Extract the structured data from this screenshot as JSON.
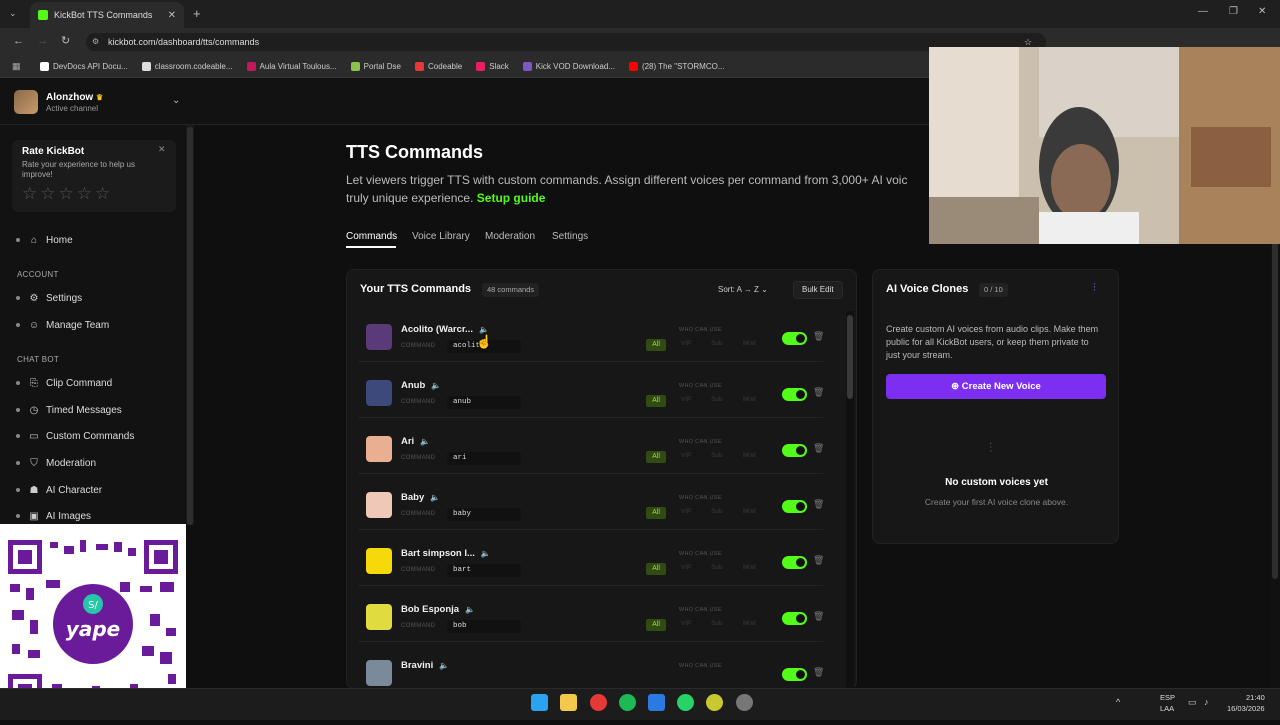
{
  "browser": {
    "tab_title": "KickBot TTS Commands",
    "url": "kickbot.com/dashboard/tts/commands",
    "bookmarks": [
      {
        "label": "DevDocs API Docu...",
        "color": "#ffffff"
      },
      {
        "label": "classroom.codeable...",
        "color": "#dddddd"
      },
      {
        "label": "Aula Virtual Toulous...",
        "color": "#c2185b"
      },
      {
        "label": "Portal Dse",
        "color": "#8bc34a"
      },
      {
        "label": "Codeable",
        "color": "#e53935"
      },
      {
        "label": "Slack",
        "color": "#e91e63"
      },
      {
        "label": "Kick VOD Download...",
        "color": "#7e57c2"
      },
      {
        "label": "(28) The \"STORMCO...",
        "color": "#ff0000"
      }
    ]
  },
  "account": {
    "name": "Alonzhow",
    "status": "Active channel"
  },
  "rate": {
    "title": "Rate KickBot",
    "text": "Rate your experience to help us improve!",
    "stars": 5
  },
  "sidebar": {
    "home": "Home",
    "account_section": "ACCOUNT",
    "settings": "Settings",
    "manage_team": "Manage Team",
    "chatbot_section": "CHAT BOT",
    "clip_command": "Clip Command",
    "timed_messages": "Timed Messages",
    "custom_commands": "Custom Commands",
    "moderation": "Moderation",
    "ai_character": "AI Character",
    "ai_images": "AI Images"
  },
  "page": {
    "title": "TTS Commands",
    "subtitle": "Let viewers trigger TTS with custom commands. Assign different voices per command from 3,000+ AI voic",
    "subtitle_line2": "truly unique experience.",
    "setup_guide": "Setup guide",
    "tabs": [
      "Commands",
      "Voice Library",
      "Moderation",
      "Settings"
    ]
  },
  "commands_panel": {
    "title": "Your TTS Commands",
    "count": "48 commands",
    "sort": "Sort: A → Z",
    "bulk_edit": "Bulk Edit",
    "command_label": "COMMAND",
    "who_label": "WHO CAN USE",
    "roles": [
      "All",
      "VIP",
      "Sub",
      "Mod"
    ],
    "rows": [
      {
        "name": "Acolito (Warcr...",
        "command": "acolito",
        "pic": "#5b3a7a"
      },
      {
        "name": "Anub",
        "command": "anub",
        "pic": "#3b4a7a"
      },
      {
        "name": "Ari",
        "command": "ari",
        "pic": "#e8b090"
      },
      {
        "name": "Baby",
        "command": "baby",
        "pic": "#f0c8b8"
      },
      {
        "name": "Bart simpson l...",
        "command": "bart",
        "pic": "#f5d90a"
      },
      {
        "name": "Bob Esponja",
        "command": "bob",
        "pic": "#e0dc40"
      },
      {
        "name": "Bravini",
        "command": "",
        "pic": "#7a8a9a"
      }
    ]
  },
  "voice_panel": {
    "title": "AI Voice Clones",
    "count": "0 / 10",
    "desc": "Create custom AI voices from audio clips. Make them public for all KickBot users, or keep them private to just your stream.",
    "create_button": "Create New Voice",
    "empty_title": "No custom voices yet",
    "empty_text": "Create your first AI voice clone above."
  },
  "taskbar": {
    "lang1": "ESP",
    "lang2": "LAA",
    "time": "21:40",
    "date": "16/03/2026"
  },
  "colors": {
    "accent": "#53fc18",
    "purple": "#7c2ff0"
  }
}
